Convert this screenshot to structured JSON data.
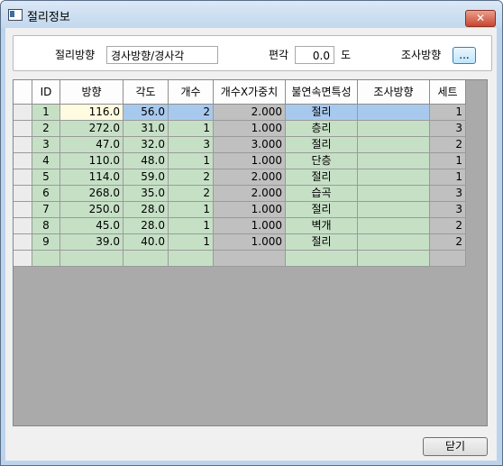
{
  "window": {
    "title": "절리정보",
    "close_glyph": "✕",
    "icon": "window-app-icon"
  },
  "top": {
    "joint_direction_label": "절리방향",
    "joint_direction_value": "경사방향/경사각",
    "declination_label": "편각",
    "declination_value": "0.0",
    "declination_unit": "도",
    "survey_direction_label": "조사방향",
    "survey_direction_button": "..."
  },
  "grid": {
    "headers": [
      "ID",
      "방향",
      "각도",
      "개수",
      "개수X가중치",
      "불연속면특성",
      "조사방향",
      "세트"
    ],
    "rows": [
      [
        "1",
        "116.0",
        "56.0",
        "2",
        "2.000",
        "절리",
        "",
        "1"
      ],
      [
        "2",
        "272.0",
        "31.0",
        "1",
        "1.000",
        "층리",
        "",
        "3"
      ],
      [
        "3",
        "47.0",
        "32.0",
        "3",
        "3.000",
        "절리",
        "",
        "2"
      ],
      [
        "4",
        "110.0",
        "48.0",
        "1",
        "1.000",
        "단층",
        "",
        "1"
      ],
      [
        "5",
        "114.0",
        "59.0",
        "2",
        "2.000",
        "절리",
        "",
        "1"
      ],
      [
        "6",
        "268.0",
        "35.0",
        "2",
        "2.000",
        "습곡",
        "",
        "3"
      ],
      [
        "7",
        "250.0",
        "28.0",
        "1",
        "1.000",
        "절리",
        "",
        "3"
      ],
      [
        "8",
        "45.0",
        "28.0",
        "1",
        "1.000",
        "벽개",
        "",
        "2"
      ],
      [
        "9",
        "39.0",
        "40.0",
        "1",
        "1.000",
        "절리",
        "",
        "2"
      ],
      [
        "",
        "",
        "",
        "",
        "",
        "",
        "",
        ""
      ]
    ],
    "colors": {
      "editable": "#c6e0c6",
      "computed": "#c0c0c0",
      "selected": "#a8c9ee",
      "active_cell": "#fffbe0",
      "empty": "#aaaaaa"
    }
  },
  "footer": {
    "close_label": "닫기"
  }
}
